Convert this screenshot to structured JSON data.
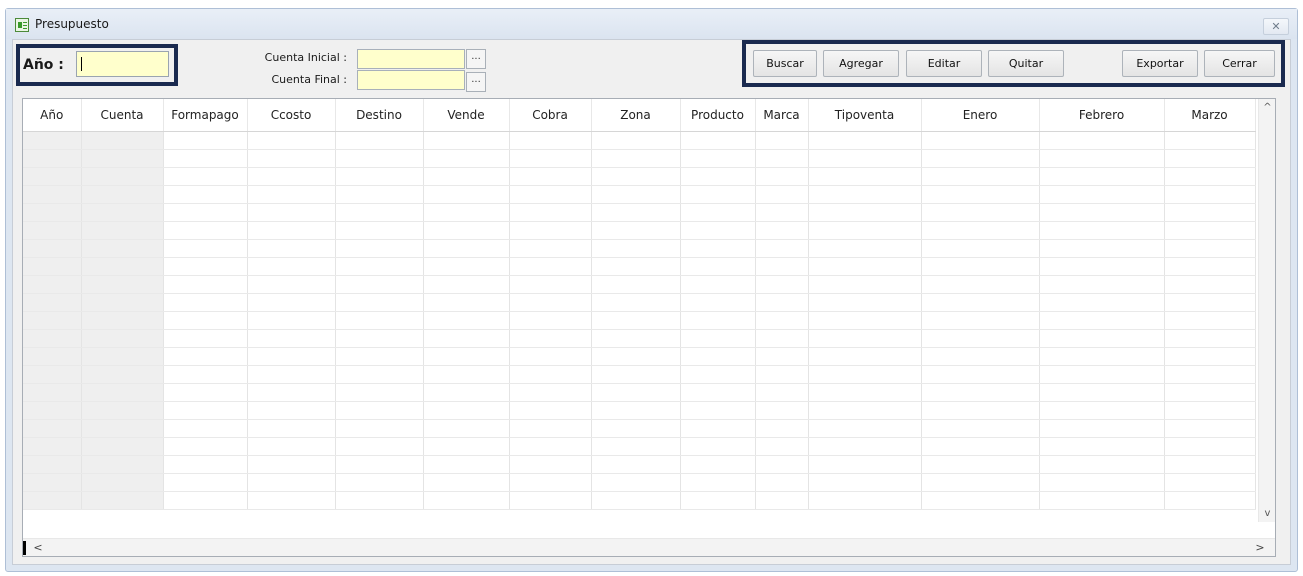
{
  "window": {
    "title": "Presupuesto",
    "close_glyph": "✕"
  },
  "filters": {
    "ano_label": "Año :",
    "ano_value": "",
    "cuenta_inicial_label": "Cuenta Inicial :",
    "cuenta_inicial_value": "",
    "cuenta_final_label": "Cuenta Final :",
    "cuenta_final_value": "",
    "picker_glyph": "..."
  },
  "toolbar": {
    "buscar": "Buscar",
    "agregar": "Agregar",
    "editar": "Editar",
    "quitar": "Quitar",
    "exportar": "Exportar",
    "cerrar": "Cerrar"
  },
  "grid": {
    "columns": [
      "Año",
      "Cuenta",
      "Formapago",
      "Ccosto",
      "Destino",
      "Vende",
      "Cobra",
      "Zona",
      "Producto",
      "Marca",
      "Tipoventa",
      "Enero",
      "Febrero",
      "Marzo"
    ],
    "rows": []
  },
  "scroll": {
    "up": "^",
    "down": "v",
    "left": "<",
    "right": ">"
  },
  "colors": {
    "input_bg": "#ffffcc",
    "highlight": "#1a2a4f",
    "window_bg": "#dde6f1"
  }
}
